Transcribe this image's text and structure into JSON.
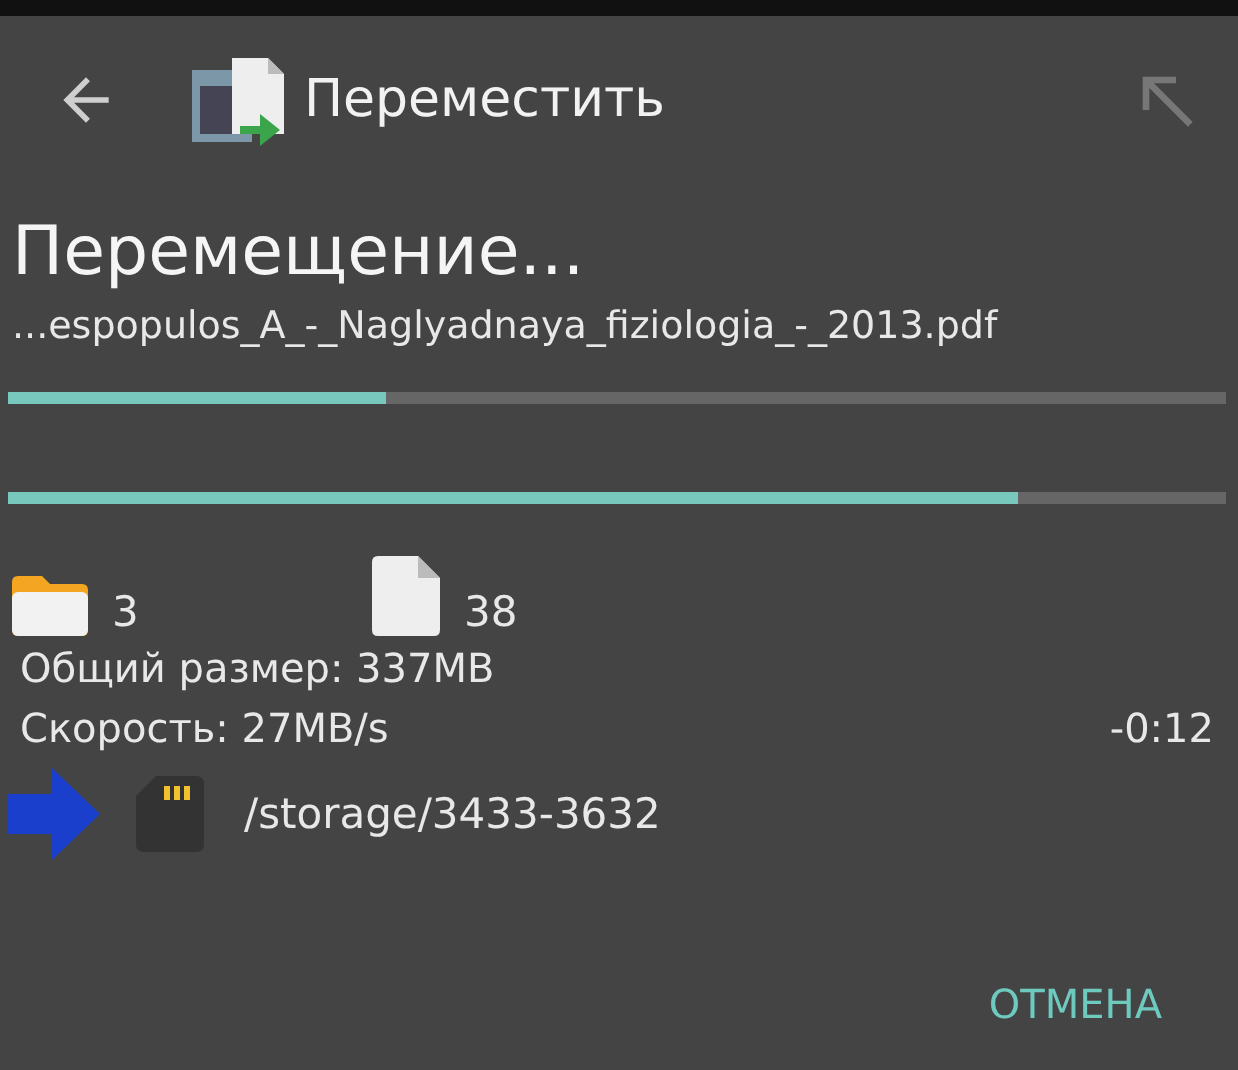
{
  "toolbar": {
    "title": "Переместить"
  },
  "heading": "Перемещение...",
  "file_name": "...espopulos_A_-_Naglyadnaya_fiziologia_-_2013.pdf",
  "progress": [
    {
      "level": 0.31
    },
    {
      "level": 0.83
    }
  ],
  "counts": {
    "folders": "3",
    "files": "38"
  },
  "total_size": "Общий размер: 337MB",
  "speed": "Скорость: 27MB/s",
  "remaining": "-0:12",
  "destination": "/storage/3433-3632",
  "buttons": [
    "ОТМЕНА"
  ]
}
